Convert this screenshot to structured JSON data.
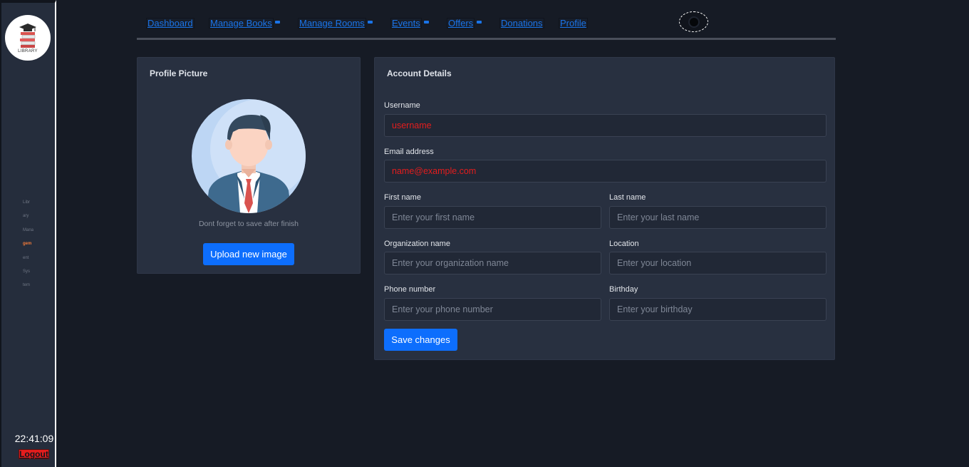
{
  "sidebar": {
    "logo_text": "LIBRARY",
    "menu_items": [
      "Libr",
      "ary",
      "Mana",
      "gem",
      "ent",
      "Sys",
      "tem"
    ],
    "active_index": 3,
    "clock": "22:41:09",
    "logout_label": "Logout"
  },
  "nav": {
    "links": [
      {
        "label": "Dashboard",
        "has_dropdown": false
      },
      {
        "label": "Manage Books",
        "has_dropdown": true
      },
      {
        "label": "Manage Rooms",
        "has_dropdown": true
      },
      {
        "label": "Events",
        "has_dropdown": true
      },
      {
        "label": "Offers",
        "has_dropdown": true
      },
      {
        "label": "Donations",
        "has_dropdown": false
      },
      {
        "label": "Profile",
        "has_dropdown": false
      }
    ],
    "theme_toggle_icon": "moon-icon"
  },
  "profile_card": {
    "title": "Profile Picture",
    "note": "Dont forget to save after finish",
    "upload_label": "Upload new image"
  },
  "account": {
    "title": "Account Details",
    "username": {
      "label": "Username",
      "value": "username"
    },
    "email": {
      "label": "Email address",
      "value": "name@example.com"
    },
    "first_name": {
      "label": "First name",
      "placeholder": "Enter your first name"
    },
    "last_name": {
      "label": "Last name",
      "placeholder": "Enter your last name"
    },
    "organization": {
      "label": "Organization name",
      "placeholder": "Enter your organization name"
    },
    "location": {
      "label": "Location",
      "placeholder": "Enter your location"
    },
    "phone": {
      "label": "Phone number",
      "placeholder": "Enter your phone number"
    },
    "birthday": {
      "label": "Birthday",
      "placeholder": "Enter your birthday"
    },
    "save_label": "Save changes"
  },
  "colors": {
    "background": "#161b25",
    "card": "#283040",
    "accent": "#0d6efd",
    "link": "#1a74e8",
    "error_text": "#e41d1d",
    "active_menu": "#f07a3a"
  }
}
